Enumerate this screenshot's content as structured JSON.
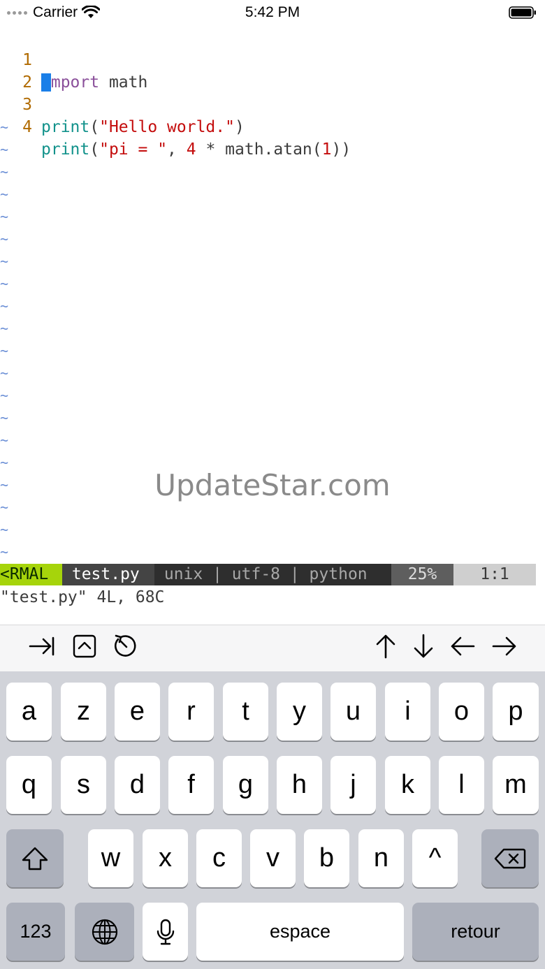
{
  "status_bar": {
    "carrier": "Carrier",
    "time": "5:42 PM"
  },
  "editor": {
    "lines": [
      {
        "number": "1",
        "cursor_char": "i",
        "tokens": [
          "mport",
          " math"
        ]
      },
      {
        "number": "2"
      },
      {
        "number": "3",
        "tokens": [
          "print",
          "(",
          "\"Hello world.\"",
          ")"
        ]
      },
      {
        "number": "4",
        "tokens": [
          "print",
          "(",
          "\"pi = \"",
          ", ",
          "4",
          " * math.atan(",
          "1",
          "))"
        ]
      }
    ],
    "tilde": "~"
  },
  "watermark": "UpdateStar.com",
  "vim_status": {
    "mode": "<RMAL",
    "file": " test.py ",
    "encoding": " unix | utf-8 | python ",
    "percent": "25%",
    "position": "1:1"
  },
  "command_line": "\"test.py\" 4L, 68C",
  "toolbar": {
    "left_icons": [
      "tab-icon",
      "control-icon",
      "escape-icon"
    ],
    "right_icons": [
      "arrow-up-icon",
      "arrow-down-icon",
      "arrow-left-icon",
      "arrow-right-icon"
    ]
  },
  "keyboard": {
    "row1": [
      "a",
      "z",
      "e",
      "r",
      "t",
      "y",
      "u",
      "i",
      "o",
      "p"
    ],
    "row2": [
      "q",
      "s",
      "d",
      "f",
      "g",
      "h",
      "j",
      "k",
      "l",
      "m"
    ],
    "row3": [
      "w",
      "x",
      "c",
      "v",
      "b",
      "n",
      "^"
    ],
    "numbers": "123",
    "space": "espace",
    "return": "retour"
  }
}
